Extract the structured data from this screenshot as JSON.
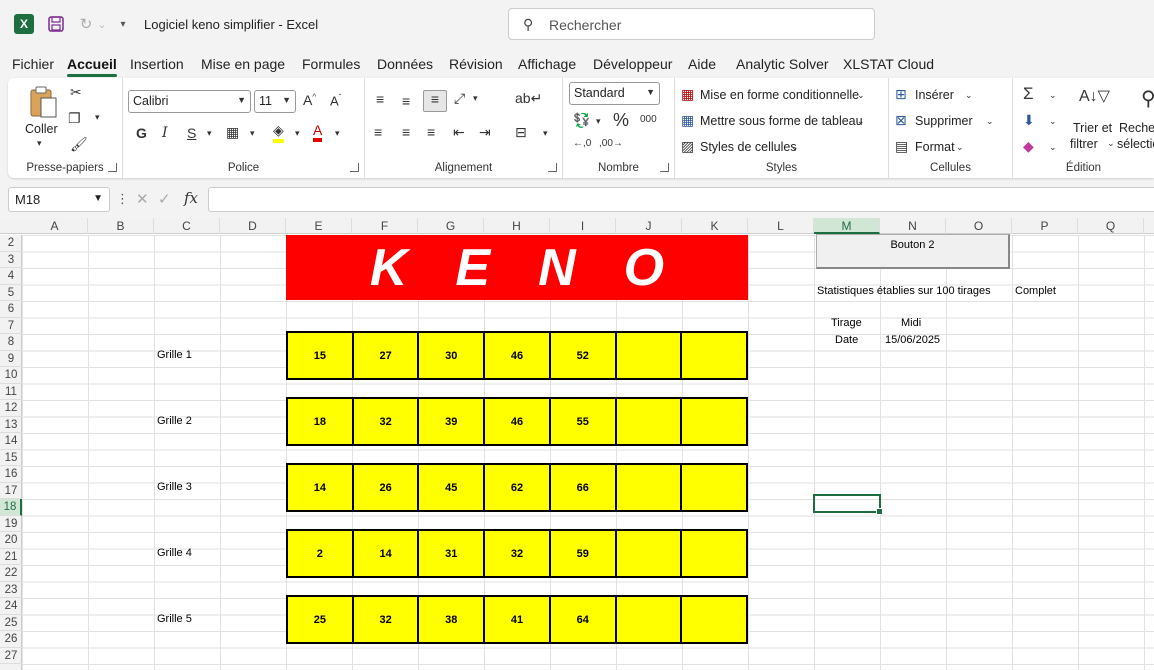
{
  "titlebar": {
    "title": "Logiciel keno simplifier  -  Excel",
    "search_placeholder": "Rechercher"
  },
  "tabs": [
    {
      "label": "Fichier"
    },
    {
      "label": "Accueil",
      "active": true
    },
    {
      "label": "Insertion"
    },
    {
      "label": "Mise en page"
    },
    {
      "label": "Formules"
    },
    {
      "label": "Données"
    },
    {
      "label": "Révision"
    },
    {
      "label": "Affichage"
    },
    {
      "label": "Développeur"
    },
    {
      "label": "Aide"
    },
    {
      "label": "Analytic Solver"
    },
    {
      "label": "XLSTAT Cloud"
    }
  ],
  "ribbon": {
    "presse_papiers": {
      "label": "Presse-papiers",
      "coller": "Coller"
    },
    "police": {
      "label": "Police",
      "font": "Calibri",
      "size": "11",
      "bold": "G",
      "italic": "I",
      "underline": "S"
    },
    "alignement": {
      "label": "Alignement"
    },
    "nombre": {
      "label": "Nombre",
      "format": "Standard"
    },
    "styles": {
      "label": "Styles",
      "mise_en_forme": "Mise en forme conditionnelle",
      "tableau": "Mettre sous forme de tableau",
      "cellules": "Styles de cellules"
    },
    "cellules": {
      "label": "Cellules",
      "inserer": "Insérer",
      "supprimer": "Supprimer",
      "format": "Format"
    },
    "edition": {
      "label": "Édition",
      "trier": "Trier et",
      "filtrer": "filtrer",
      "rechercher": "Recher",
      "selection": "sélectio"
    }
  },
  "formula_bar": {
    "name_box": "M18",
    "formula": ""
  },
  "columns": [
    "A",
    "B",
    "C",
    "D",
    "E",
    "F",
    "G",
    "H",
    "I",
    "J",
    "K",
    "L",
    "M",
    "N",
    "O",
    "P",
    "Q"
  ],
  "selected_column": "M",
  "rows": [
    "2",
    "3",
    "4",
    "5",
    "6",
    "7",
    "8",
    "9",
    "10",
    "11",
    "12",
    "13",
    "14",
    "15",
    "16",
    "17",
    "18",
    "19",
    "20",
    "21",
    "22",
    "23",
    "24",
    "25",
    "26",
    "27"
  ],
  "selected_row": "18",
  "sheet": {
    "banner": "KENO",
    "button_label": "Bouton 2",
    "stats_text": "Statistiques établies sur 100 tirages",
    "stats_complete": "Complet",
    "tirage_label": "Tirage",
    "tirage_value": "Midi",
    "date_label": "Date",
    "date_value": "15/06/2025",
    "grilles": [
      {
        "label": "Grille 1",
        "numbers": [
          "15",
          "27",
          "30",
          "46",
          "52",
          "",
          ""
        ]
      },
      {
        "label": "Grille 2",
        "numbers": [
          "18",
          "32",
          "39",
          "46",
          "55",
          "",
          ""
        ]
      },
      {
        "label": "Grille 3",
        "numbers": [
          "14",
          "26",
          "45",
          "62",
          "66",
          "",
          ""
        ]
      },
      {
        "label": "Grille 4",
        "numbers": [
          "2",
          "14",
          "31",
          "32",
          "59",
          "",
          ""
        ]
      },
      {
        "label": "Grille 5",
        "numbers": [
          "25",
          "32",
          "38",
          "41",
          "64",
          "",
          ""
        ]
      }
    ]
  },
  "colors": {
    "excel_green": "#1d6f42",
    "banner_red": "#ff0000",
    "grid_yellow": "#ffff00"
  }
}
